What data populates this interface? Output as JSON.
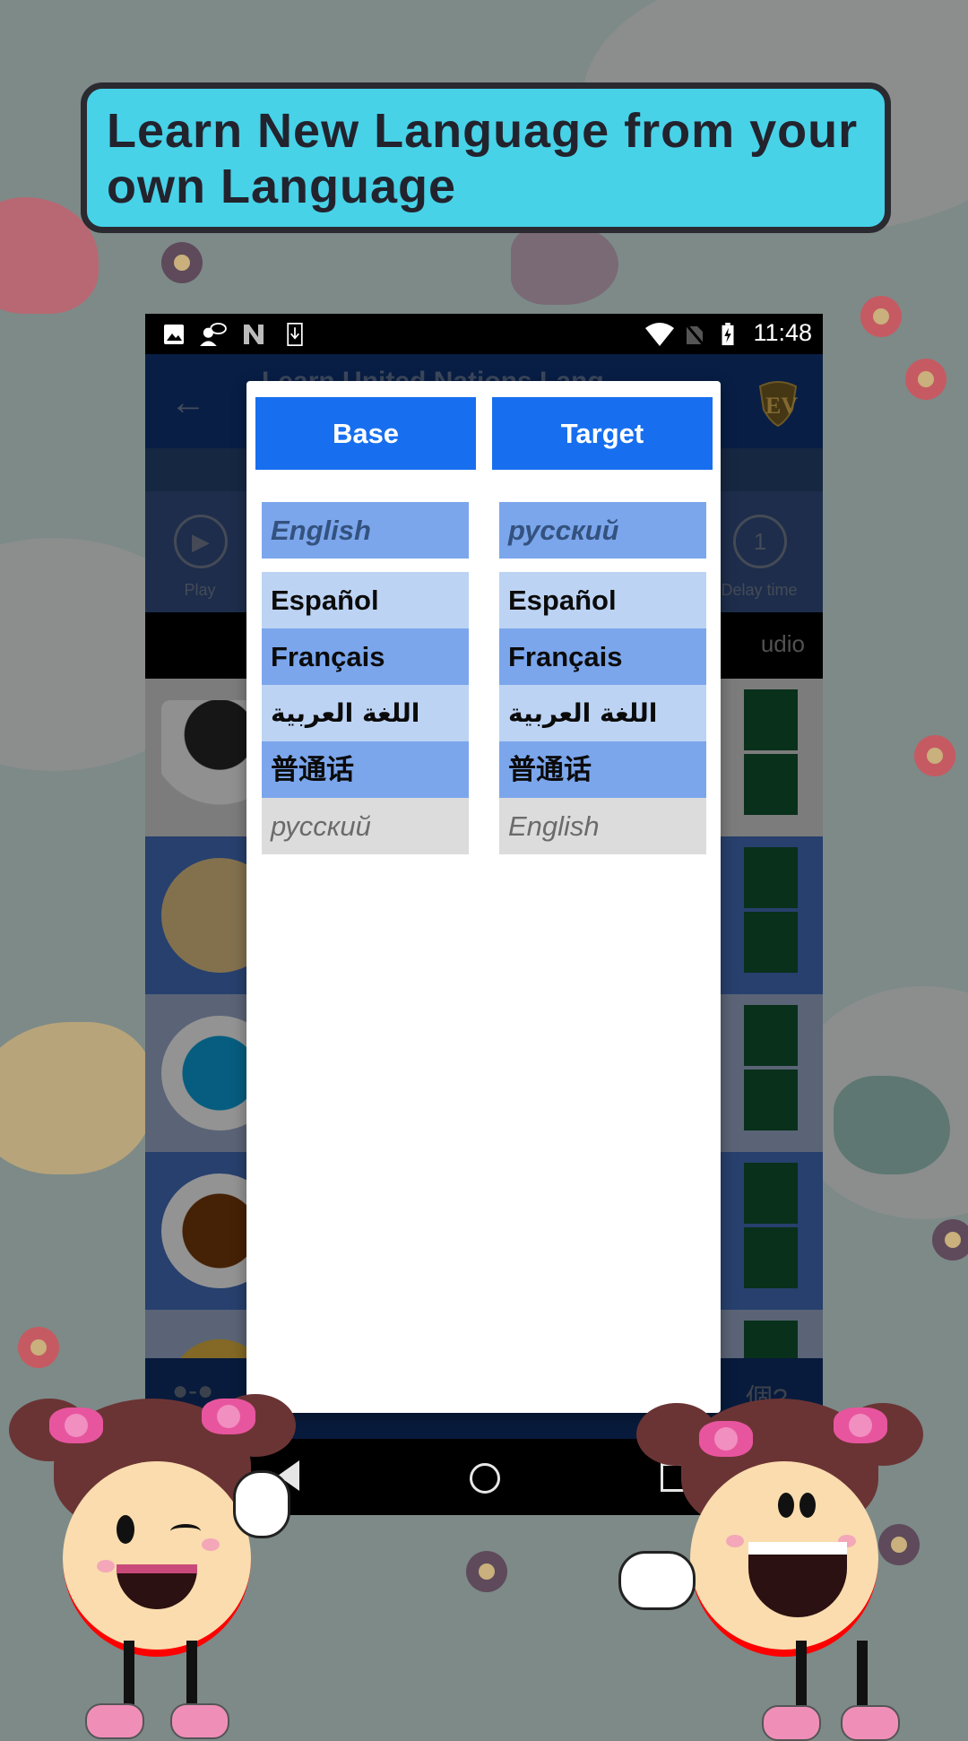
{
  "banner": {
    "title": "Learn New Language from your own Language",
    "bg_color": "#47d2e8"
  },
  "statusbar": {
    "left_icons": [
      "gallery-icon",
      "voice-chat-icon",
      "n-icon",
      "download-icon"
    ],
    "right_icons": [
      "wifi-icon",
      "no-sim-icon",
      "battery-charging-icon"
    ],
    "time": "11:48"
  },
  "app": {
    "title": "Learn United Nations Lang...",
    "back_icon": "arrow-left-icon",
    "logo": "EV",
    "toolbar": {
      "play_label": "Play",
      "delay_value": "1",
      "delay_label": "Delay time"
    },
    "strip_text": "udio",
    "rows": [
      {
        "image": "black-paint-bucket",
        "actions": [
          "edit-icon",
          "owl-icon"
        ]
      },
      {
        "image": "beige-circle",
        "actions": [
          "edit-icon",
          "owl-icon"
        ]
      },
      {
        "image": "blue-splash",
        "actions": [
          "edit-icon",
          "owl-icon"
        ]
      },
      {
        "image": "brown-splash",
        "actions": [
          "edit-icon",
          "owl-icon"
        ]
      },
      {
        "image": "colorful-leaves",
        "actions": [
          "edit-icon"
        ]
      }
    ],
    "bottom_nav_right_text": "個?"
  },
  "dialog": {
    "base_label": "Base",
    "target_label": "Target",
    "base": {
      "selected": "English",
      "options": [
        {
          "label": "Español",
          "style": "light"
        },
        {
          "label": "Français",
          "style": "mid"
        },
        {
          "label": "اللغة العربية",
          "style": "light"
        },
        {
          "label": "普通话",
          "style": "mid"
        },
        {
          "label": "русский",
          "style": "disabled"
        }
      ]
    },
    "target": {
      "selected": "русский",
      "options": [
        {
          "label": "Español",
          "style": "light"
        },
        {
          "label": "Français",
          "style": "mid"
        },
        {
          "label": "اللغة العربية",
          "style": "light"
        },
        {
          "label": "普通话",
          "style": "mid"
        },
        {
          "label": "English",
          "style": "disabled"
        }
      ]
    },
    "accent_color": "#176fef"
  },
  "characters": [
    {
      "name": "girl-winking-ok",
      "gesture": "ok-hand"
    },
    {
      "name": "girl-laughing-thumbs-up",
      "gesture": "thumbs-up"
    }
  ]
}
